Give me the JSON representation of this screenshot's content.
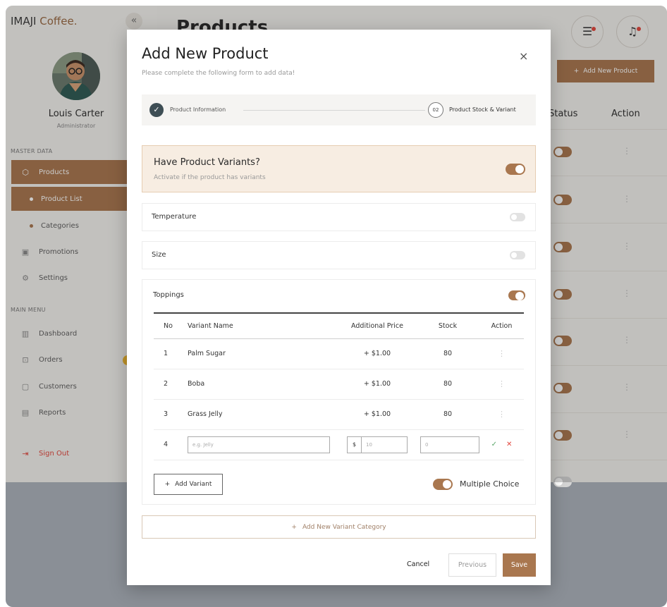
{
  "app": {
    "brand_main": "IMAJI",
    "brand_accent": "Coffee.",
    "collapse_icon": "«"
  },
  "user": {
    "name": "Louis Carter",
    "role": "Administrator"
  },
  "sidebar": {
    "section_master": "MASTER DATA",
    "section_main": "MAIN MENU",
    "items": {
      "products": "Products",
      "product_list": "Product List",
      "categories": "Categories",
      "promotions": "Promotions",
      "settings": "Settings",
      "dashboard": "Dashboard",
      "orders": "Orders",
      "customers": "Customers",
      "reports": "Reports",
      "sign_out": "Sign Out"
    }
  },
  "page": {
    "title": "Products",
    "add_button": "Add New Product",
    "columns": {
      "status": "Status",
      "action": "Action"
    }
  },
  "modal": {
    "title": "Add New Product",
    "subtitle": "Please complete the following form to add data!",
    "close": "×",
    "steps": {
      "step1": "Product Information",
      "step2_num": "02",
      "step2": "Product Stock & Variant"
    },
    "variants_question": "Have Product Variants?",
    "variants_hint": "Activate if the product has variants",
    "categories": {
      "temperature": "Temperature",
      "size": "Size",
      "toppings": "Toppings"
    },
    "table": {
      "headers": {
        "no": "No",
        "name": "Variant Name",
        "price": "Additional Price",
        "stock": "Stock",
        "action": "Action"
      },
      "rows": [
        {
          "no": "1",
          "name": "Palm Sugar",
          "price": "+ $1.00",
          "stock": "80"
        },
        {
          "no": "2",
          "name": "Boba",
          "price": "+ $1.00",
          "stock": "80"
        },
        {
          "no": "3",
          "name": "Grass Jelly",
          "price": "+ $1.00",
          "stock": "80"
        }
      ],
      "new_row": {
        "no": "4",
        "name_placeholder": "e.g. Jelly",
        "currency": "$",
        "price_placeholder": "10",
        "stock_placeholder": "0"
      }
    },
    "add_variant": "Add Variant",
    "multiple_choice": "Multiple Choice",
    "add_category": "Add New Variant Category",
    "buttons": {
      "cancel": "Cancel",
      "previous": "Previous",
      "save": "Save"
    }
  },
  "colors": {
    "accent": "#a9774f",
    "danger": "#e2473d",
    "dark": "#3e4e55"
  }
}
